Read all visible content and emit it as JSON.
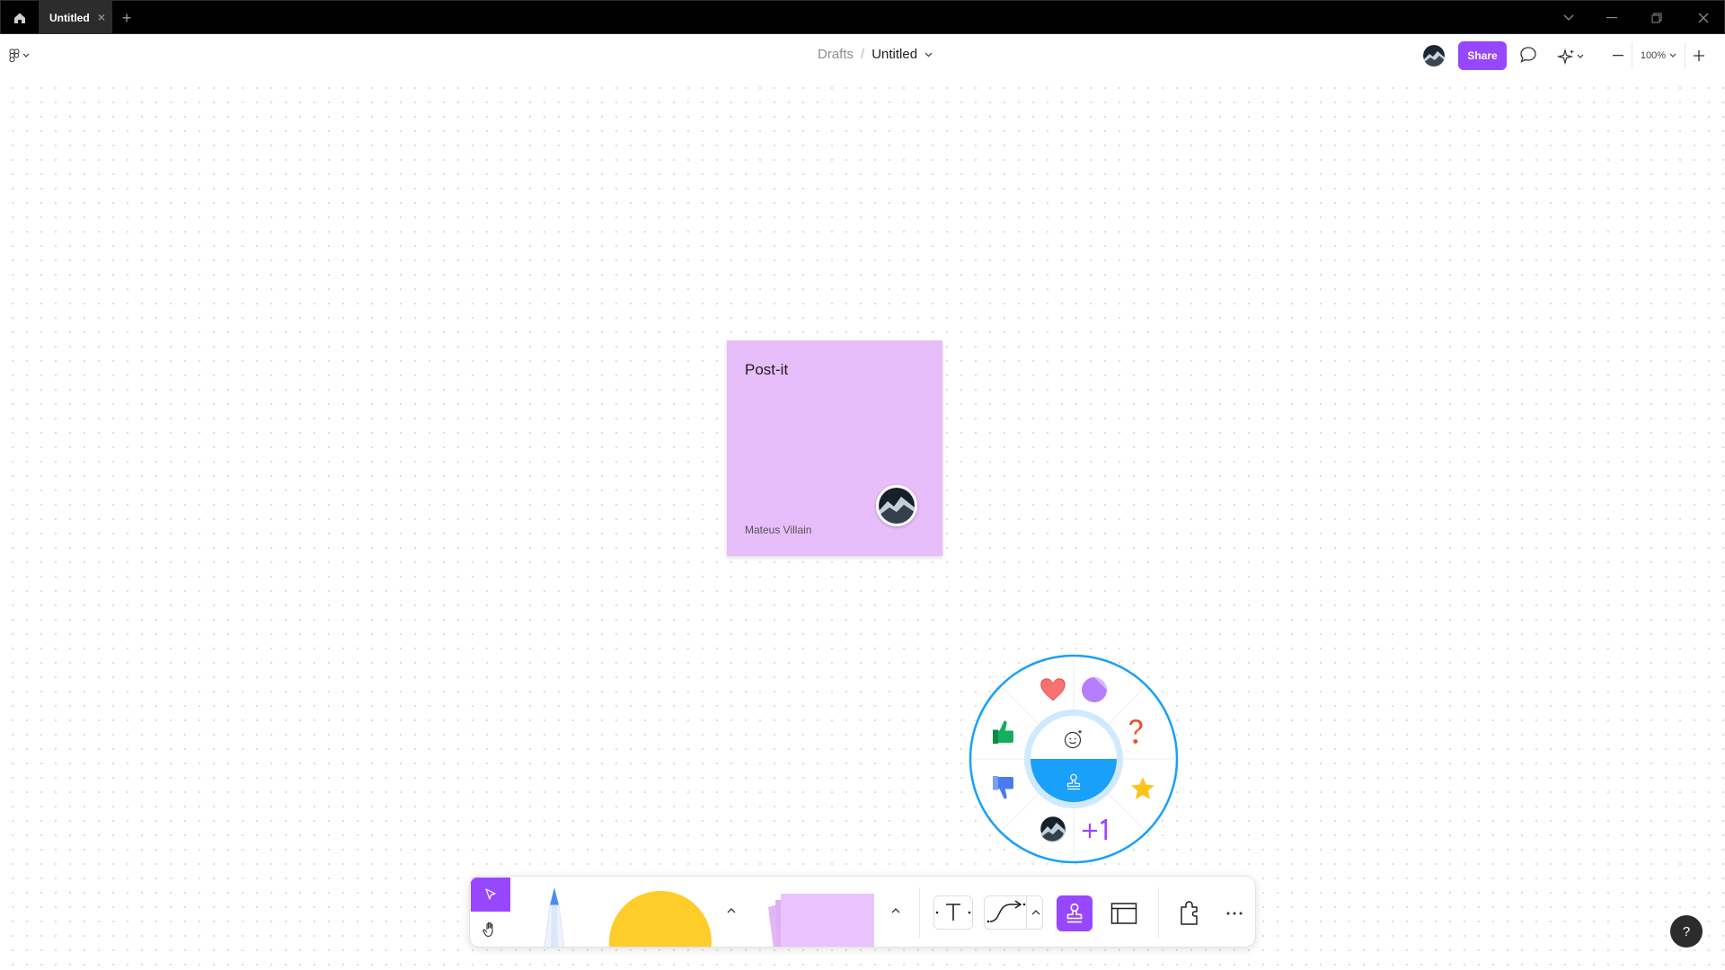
{
  "titlebar": {
    "tab_label": "Untitled",
    "tab_close": "×",
    "new_tab": "+"
  },
  "header": {
    "breadcrumb_parent": "Drafts",
    "breadcrumb_separator": "/",
    "file_title": "Untitled",
    "share_label": "Share",
    "zoom_value": "100%"
  },
  "canvas": {
    "sticky": {
      "text": "Post-it",
      "author": "Mateus Villain",
      "color": "#e7bdfa"
    },
    "stamp_wheel": {
      "ring_color": "#18a0fb",
      "stamps": [
        "heart-icon",
        "sticker-icon",
        "question-icon",
        "star-icon",
        "plus-one-icon",
        "avatar-stamp",
        "thumbs-down-icon",
        "thumbs-up-icon"
      ],
      "center_top": "emoji-icon",
      "center_bottom": "stamp-icon"
    }
  },
  "toolbar": {
    "accent": "#9747ff",
    "tools": [
      "move-tool",
      "hand-tool",
      "marker-tool",
      "shape-tool",
      "sticky-tool",
      "text-tool",
      "connector-tool",
      "stamp-tool",
      "section-tool",
      "plugins-tool",
      "more-tool"
    ]
  },
  "help": {
    "label": "?"
  }
}
